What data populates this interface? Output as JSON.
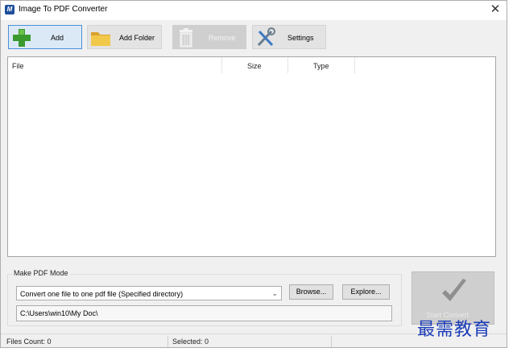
{
  "window": {
    "title": "Image To PDF Converter",
    "close_symbol": "✕"
  },
  "toolbar": {
    "add_label": "Add",
    "add_folder_label": "Add Folder",
    "remove_label": "Remove",
    "settings_label": "Settings"
  },
  "file_list": {
    "columns": [
      "File",
      "Size",
      "Type"
    ],
    "rows": []
  },
  "mode": {
    "legend": "Make PDF Mode",
    "selected_option": "Convert one file to one pdf file (Specified directory)",
    "browse_label": "Browse...",
    "explore_label": "Explore...",
    "output_path": "C:\\Users\\win10\\My Doc\\"
  },
  "start": {
    "label": "Start Convert"
  },
  "status": {
    "files_count": "Files Count: 0",
    "selected": "Selected: 0"
  },
  "watermark": {
    "text": "最需教育"
  },
  "colors": {
    "window_bg": "#f0f0f0",
    "selected_border": "#4a90d9",
    "add_icon": "#3a9a2e",
    "folder_icon": "#e8b63c"
  },
  "icons": {
    "app": "app-logo-icon",
    "add": "plus-icon",
    "add_folder": "folder-icon",
    "remove": "trash-icon",
    "settings": "tools-icon",
    "start": "checkmark-icon"
  }
}
